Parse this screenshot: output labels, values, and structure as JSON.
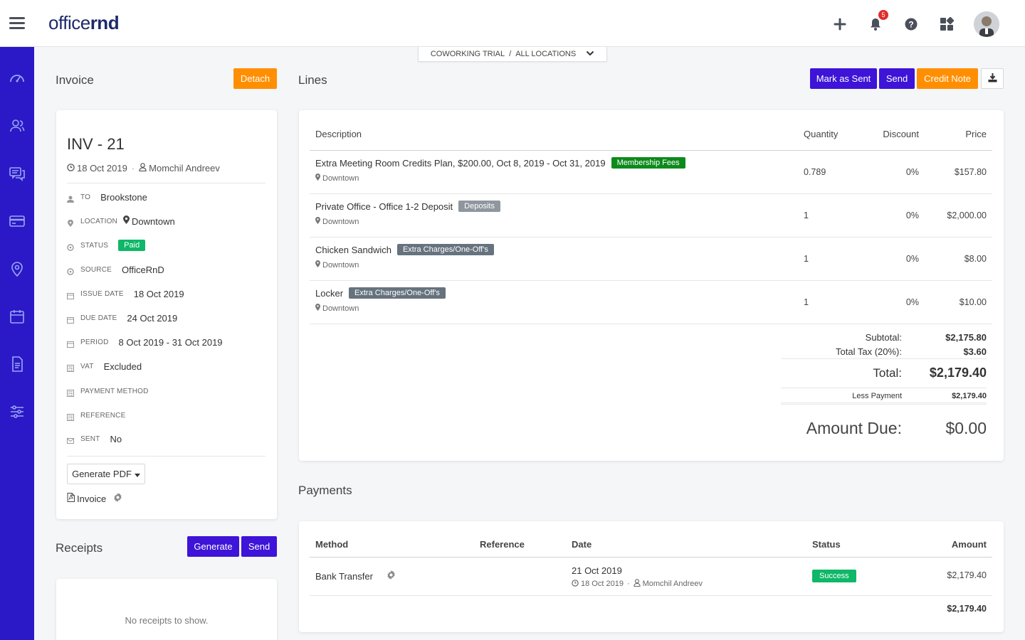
{
  "app": {
    "logo_prefix": "office",
    "logo_suffix": "rnd",
    "notification_count": "5"
  },
  "location_selector": {
    "left": "COWORKING TRIAL",
    "sep": "/",
    "right": "ALL LOCATIONS"
  },
  "icons": {
    "sidebar": [
      "dashboard-icon",
      "members-icon",
      "messages-icon",
      "billing-icon",
      "locations-icon",
      "calendar-icon",
      "documents-icon",
      "settings-icon"
    ],
    "topbar": [
      "plus-icon",
      "bell-icon",
      "help-icon",
      "apps-icon"
    ]
  },
  "colors": {
    "sidebar": "#2b19c7",
    "primary_button": "#3d14d8",
    "orange_button": "#ff8f00",
    "success": "#0fb768"
  },
  "invoice": {
    "title": "Invoice",
    "detach_label": "Detach",
    "number": "INV - 21",
    "date": "18 Oct 2019",
    "author": "Momchil Andreev",
    "fields": {
      "to": {
        "label": "TO",
        "value": "Brookstone"
      },
      "location": {
        "label": "LOCATION",
        "value": "Downtown"
      },
      "status": {
        "label": "STATUS",
        "value": "Paid"
      },
      "source": {
        "label": "SOURCE",
        "value": "OfficeRnD"
      },
      "issue_date": {
        "label": "ISSUE DATE",
        "value": "18 Oct 2019"
      },
      "due_date": {
        "label": "DUE DATE",
        "value": "24 Oct 2019"
      },
      "period": {
        "label": "PERIOD",
        "value": "8 Oct 2019 - 31 Oct 2019"
      },
      "vat": {
        "label": "VAT",
        "value": "Excluded"
      },
      "payment_method": {
        "label": "PAYMENT METHOD",
        "value": ""
      },
      "reference": {
        "label": "REFERENCE",
        "value": ""
      },
      "sent": {
        "label": "SENT",
        "value": "No"
      }
    },
    "generate_pdf_label": "Generate PDF",
    "pdf_file_label": "Invoice"
  },
  "receipts": {
    "title": "Receipts",
    "generate_label": "Generate",
    "send_label": "Send",
    "empty_text": "No receipts to show."
  },
  "lines": {
    "title": "Lines",
    "mark_as_sent_label": "Mark as Sent",
    "send_label": "Send",
    "credit_note_label": "Credit Note",
    "columns": {
      "description": "Description",
      "quantity": "Quantity",
      "discount": "Discount",
      "price": "Price"
    },
    "rows": [
      {
        "description": "Extra Meeting Room Credits Plan, $200.00, Oct 8, 2019 - Oct 31, 2019",
        "tag": "Membership Fees",
        "location": "Downtown",
        "quantity": "0.789",
        "discount": "0%",
        "price": "$157.80"
      },
      {
        "description": "Private Office - Office 1-2 Deposit",
        "tag": "Deposits",
        "location": "Downtown",
        "quantity": "1",
        "discount": "0%",
        "price": "$2,000.00"
      },
      {
        "description": "Chicken Sandwich",
        "tag": "Extra Charges/One-Off's",
        "location": "Downtown",
        "quantity": "1",
        "discount": "0%",
        "price": "$8.00"
      },
      {
        "description": "Locker",
        "tag": "Extra Charges/One-Off's",
        "location": "Downtown",
        "quantity": "1",
        "discount": "0%",
        "price": "$10.00"
      }
    ],
    "totals": {
      "subtotal_label": "Subtotal:",
      "subtotal": "$2,175.80",
      "tax_label": "Total Tax (20%):",
      "tax": "$3.60",
      "total_label": "Total:",
      "total": "$2,179.40",
      "less_payment_label": "Less Payment",
      "less_payment": "$2,179.40",
      "amount_due_label": "Amount Due:",
      "amount_due": "$0.00"
    }
  },
  "payments": {
    "title": "Payments",
    "columns": {
      "method": "Method",
      "reference": "Reference",
      "date": "Date",
      "status": "Status",
      "amount": "Amount"
    },
    "rows": [
      {
        "method": "Bank Transfer",
        "reference": "",
        "date": "21 Oct 2019",
        "created": "18 Oct 2019",
        "author": "Momchil Andreev",
        "status": "Success",
        "amount": "$2,179.40"
      }
    ],
    "total": "$2,179.40"
  }
}
